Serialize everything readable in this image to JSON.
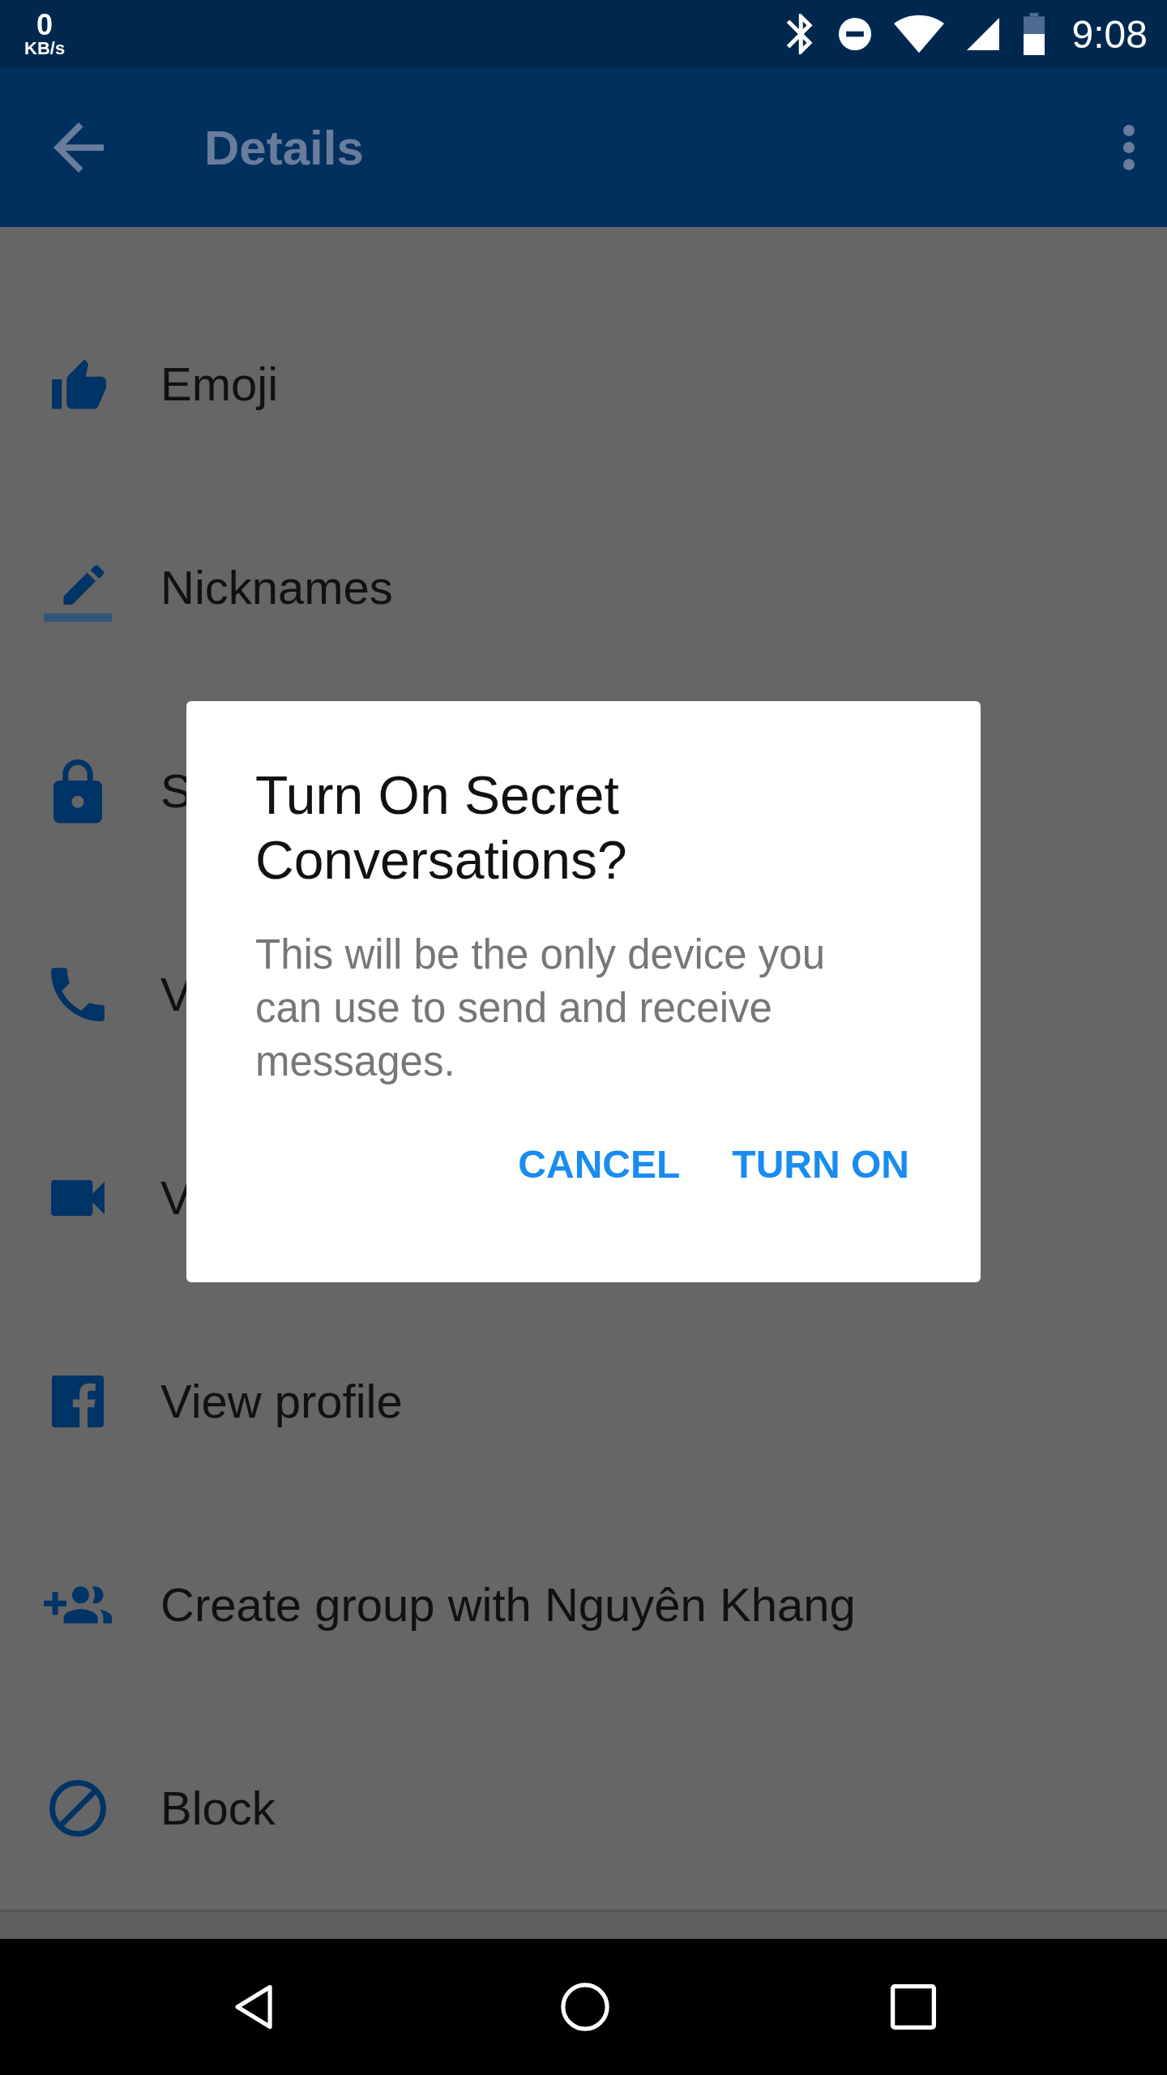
{
  "status_bar": {
    "speed_value": "0",
    "speed_unit": "KB/s",
    "time": "9:08"
  },
  "app_bar": {
    "title": "Details"
  },
  "menu_items": [
    {
      "kind": "thumb",
      "label": "Emoji"
    },
    {
      "kind": "pencil",
      "label": "Nicknames"
    },
    {
      "kind": "lock",
      "label": "S"
    },
    {
      "kind": "phone",
      "label": "V"
    },
    {
      "kind": "video",
      "label": "V"
    },
    {
      "kind": "facebook",
      "label": "View profile"
    },
    {
      "kind": "group-add",
      "label": "Create group with Nguyên Khang"
    },
    {
      "kind": "block",
      "label": "Block"
    }
  ],
  "dialog": {
    "title": "Turn On Secret Conversations?",
    "message": "This will be the only device you can use to send and receive messages.",
    "buttons": [
      {
        "label": "CANCEL"
      },
      {
        "label": "TURN ON"
      }
    ]
  }
}
